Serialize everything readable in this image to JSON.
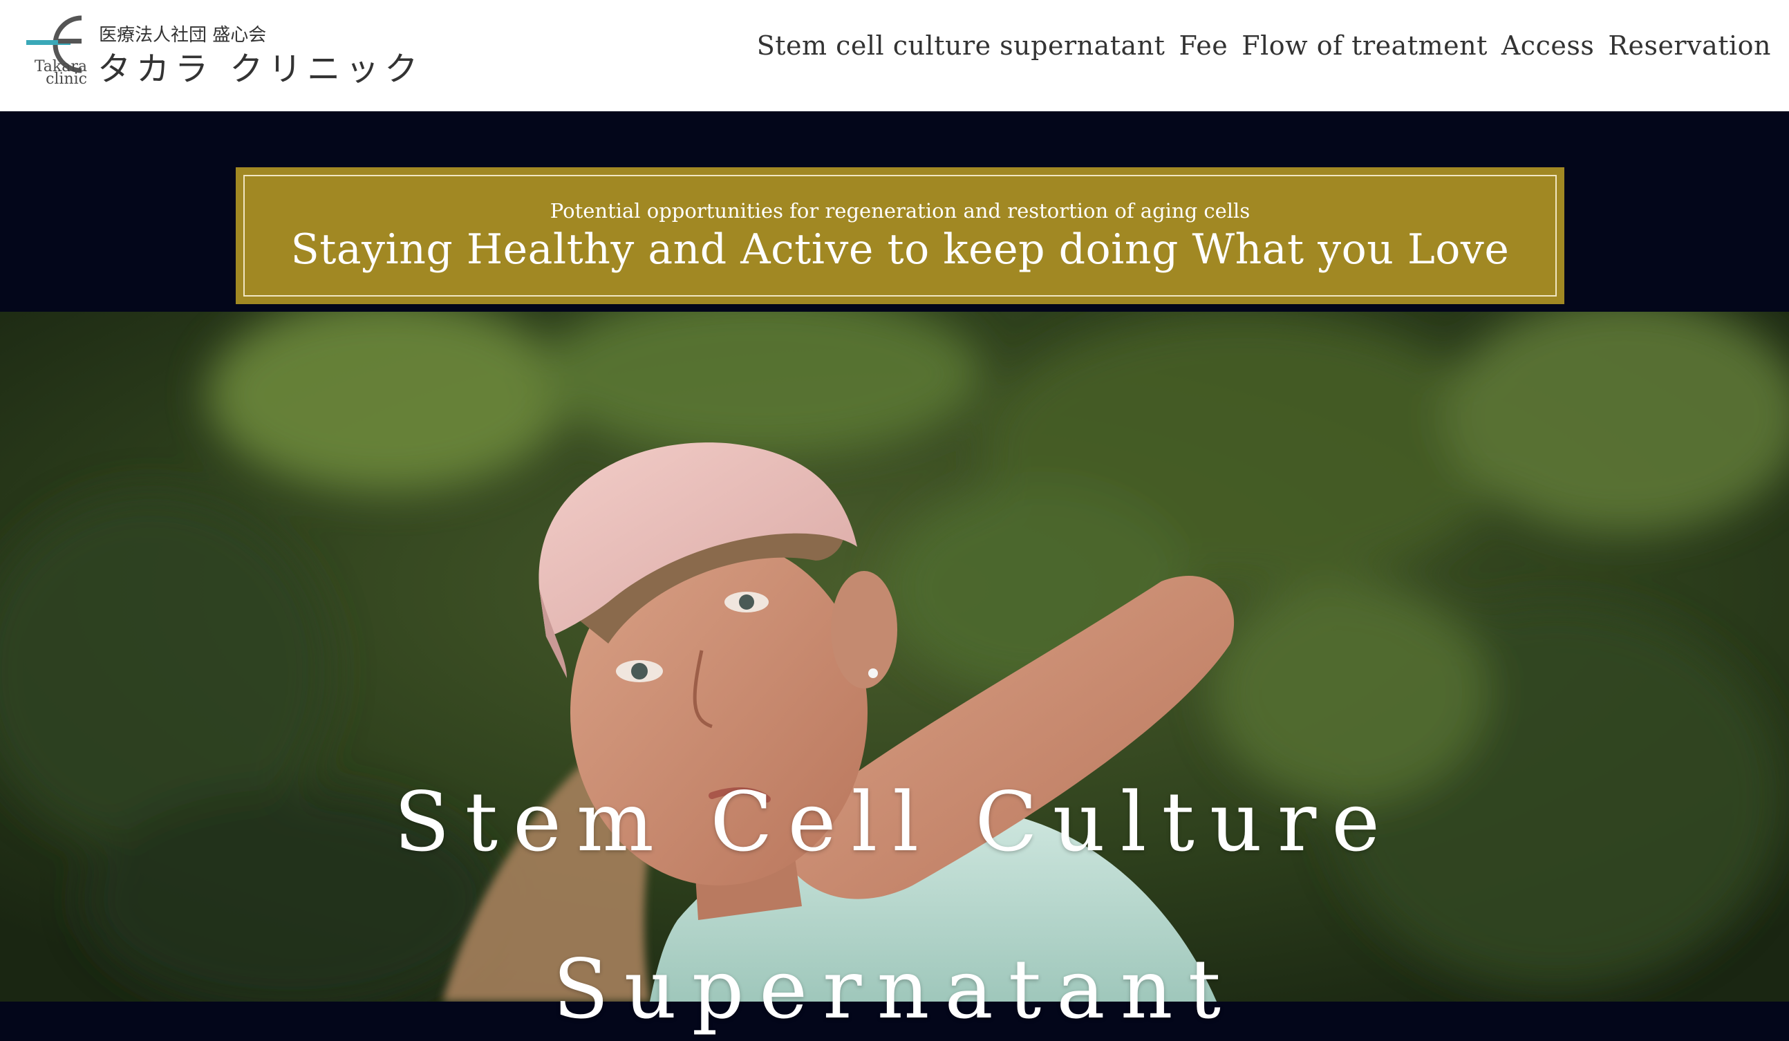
{
  "logo": {
    "org": "医療法人社団 盛心会",
    "name": "タカラ クリニック",
    "latin_top": "Takara",
    "latin_bottom": "clinic",
    "accent": "#3aa8b8"
  },
  "nav": {
    "items": [
      {
        "label": "Stem cell culture supernatant"
      },
      {
        "label": "Fee"
      },
      {
        "label": "Flow of treatment"
      },
      {
        "label": "Access"
      },
      {
        "label": "Reservation"
      }
    ]
  },
  "banner": {
    "subtitle": "Potential opportunities for regeneration and restortion of aging cells",
    "title": "Staying Healthy and Active to keep doing What you Love",
    "color": "#a18823"
  },
  "hero": {
    "title_line1": "Stem Cell Culture",
    "title_line2": "Supernatant",
    "photo_subject": "golfer-photo"
  },
  "colors": {
    "page_background": "#03061a",
    "header_background": "#ffffff"
  }
}
